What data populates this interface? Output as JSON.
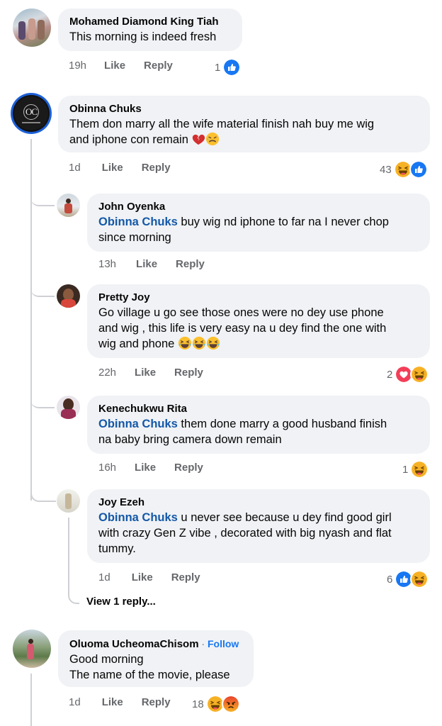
{
  "comments": [
    {
      "name": "Mohamed Diamond King Tiah",
      "text": "This morning is indeed fresh",
      "time": "19h",
      "like": "Like",
      "reply": "Reply",
      "reactions": "1"
    },
    {
      "name": "Obinna Chuks",
      "text_l1": "Them don marry all the wife material finish nah buy me wig",
      "text_l2": "and iphone con remain",
      "avatar_text": "OC",
      "time": "1d",
      "like": "Like",
      "reply": "Reply",
      "reactions": "43",
      "replies": [
        {
          "name": "John Oyenka",
          "mention": "Obinna Chuks",
          "text_l1": " buy wig nd iphone to far na I never chop",
          "text_l2": "since morning",
          "time": "13h",
          "like": "Like",
          "reply": "Reply"
        },
        {
          "name": "Pretty Joy",
          "text_l1": "Go village u go see those ones were no dey use phone",
          "text_l2": "and wig , this life is very easy na u dey find the one with",
          "text_l3": "wig and phone",
          "time": "22h",
          "like": "Like",
          "reply": "Reply",
          "reactions": "2"
        },
        {
          "name": "Kenechukwu Rita",
          "mention": "Obinna Chuks",
          "text_l1": " them done marry a good husband finish",
          "text_l2": "na baby bring camera down remain",
          "time": "16h",
          "like": "Like",
          "reply": "Reply",
          "reactions": "1"
        },
        {
          "name": "Joy Ezeh",
          "mention": "Obinna Chuks",
          "text_l1": " u never see because u dey find good girl",
          "text_l2": "with crazy Gen Z vibe , decorated with big nyash and flat",
          "text_l3": "tummy.",
          "time": "1d",
          "like": "Like",
          "reply": "Reply",
          "reactions": "6"
        }
      ],
      "view_more": "View 1 reply..."
    },
    {
      "name": "Oluoma UcheomaChisom",
      "follow": "Follow",
      "follow_sep": " · ",
      "text_l1": "Good morning",
      "text_l2": "The name of the movie, please",
      "time": "1d",
      "like": "Like",
      "reply": "Reply",
      "reactions": "18"
    }
  ],
  "icons": {
    "like": "like-reaction-icon",
    "haha": "haha-reaction-icon",
    "love": "love-reaction-icon",
    "angry": "angry-reaction-icon",
    "heartbreak": "broken-heart-emoji",
    "laugh": "laughing-emoji"
  },
  "colors": {
    "like_blue": "#1877f2",
    "love_red": "#f33e58",
    "haha_yellow": "#f7b125",
    "mention_blue": "#1458a8",
    "bubble_bg": "#f0f2f5"
  }
}
